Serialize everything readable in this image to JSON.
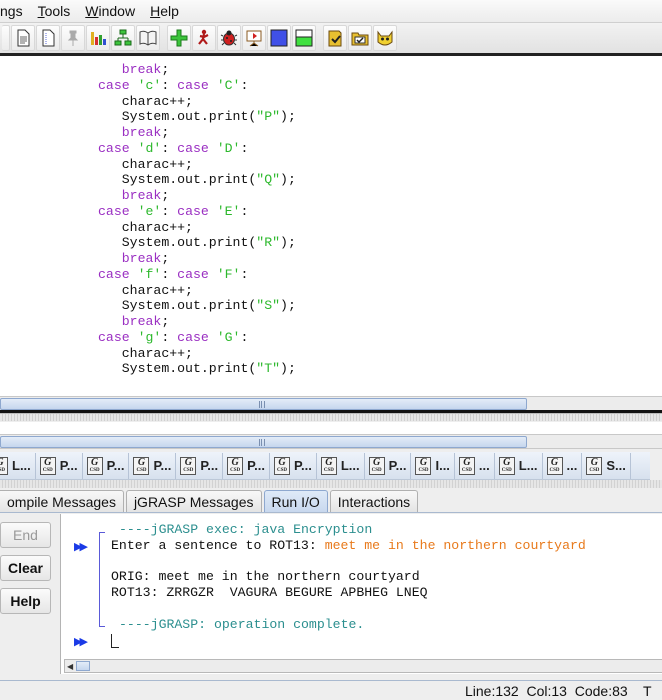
{
  "menubar": {
    "items": [
      {
        "label": "ngs",
        "mnemonic": ""
      },
      {
        "label": "Tools",
        "mnemonic": "T"
      },
      {
        "label": "Window",
        "mnemonic": "W"
      },
      {
        "label": "Help",
        "mnemonic": "H"
      }
    ]
  },
  "toolbar": {
    "icons": [
      "partial-icon",
      "new-file-icon",
      "new-doc-icon",
      "pin-icon",
      "bar-chart-icon",
      "hierarchy-icon",
      "book-icon",
      "add-icon",
      "run-icon",
      "debug-bug-icon",
      "presentation-icon",
      "blue-square-icon",
      "green-panel-icon",
      "checklist-icon",
      "folder-check-icon",
      "cat-icon"
    ]
  },
  "editor": {
    "lines": [
      {
        "indent": "   ",
        "parts": [
          {
            "t": "break",
            "c": "kw"
          },
          {
            "t": ";",
            "c": ""
          }
        ]
      },
      {
        "indent": "",
        "parts": [
          {
            "t": "case",
            "c": "kw"
          },
          {
            "t": " ",
            "c": ""
          },
          {
            "t": "'c'",
            "c": "str"
          },
          {
            "t": ": ",
            "c": ""
          },
          {
            "t": "case",
            "c": "kw"
          },
          {
            "t": " ",
            "c": ""
          },
          {
            "t": "'C'",
            "c": "str"
          },
          {
            "t": ":",
            "c": ""
          }
        ]
      },
      {
        "indent": "   ",
        "parts": [
          {
            "t": "charac++;",
            "c": ""
          }
        ]
      },
      {
        "indent": "   ",
        "parts": [
          {
            "t": "System.out.print(",
            "c": ""
          },
          {
            "t": "\"P\"",
            "c": "str"
          },
          {
            "t": ");",
            "c": ""
          }
        ]
      },
      {
        "indent": "   ",
        "parts": [
          {
            "t": "break",
            "c": "kw"
          },
          {
            "t": ";",
            "c": ""
          }
        ]
      },
      {
        "indent": "",
        "parts": [
          {
            "t": "case",
            "c": "kw"
          },
          {
            "t": " ",
            "c": ""
          },
          {
            "t": "'d'",
            "c": "str"
          },
          {
            "t": ": ",
            "c": ""
          },
          {
            "t": "case",
            "c": "kw"
          },
          {
            "t": " ",
            "c": ""
          },
          {
            "t": "'D'",
            "c": "str"
          },
          {
            "t": ":",
            "c": ""
          }
        ]
      },
      {
        "indent": "   ",
        "parts": [
          {
            "t": "charac++;",
            "c": ""
          }
        ]
      },
      {
        "indent": "   ",
        "parts": [
          {
            "t": "System.out.print(",
            "c": ""
          },
          {
            "t": "\"Q\"",
            "c": "str"
          },
          {
            "t": ");",
            "c": ""
          }
        ]
      },
      {
        "indent": "   ",
        "parts": [
          {
            "t": "break",
            "c": "kw"
          },
          {
            "t": ";",
            "c": ""
          }
        ]
      },
      {
        "indent": "",
        "parts": [
          {
            "t": "case",
            "c": "kw"
          },
          {
            "t": " ",
            "c": ""
          },
          {
            "t": "'e'",
            "c": "str"
          },
          {
            "t": ": ",
            "c": ""
          },
          {
            "t": "case",
            "c": "kw"
          },
          {
            "t": " ",
            "c": ""
          },
          {
            "t": "'E'",
            "c": "str"
          },
          {
            "t": ":",
            "c": ""
          }
        ]
      },
      {
        "indent": "   ",
        "parts": [
          {
            "t": "charac++;",
            "c": ""
          }
        ]
      },
      {
        "indent": "   ",
        "parts": [
          {
            "t": "System.out.print(",
            "c": ""
          },
          {
            "t": "\"R\"",
            "c": "str"
          },
          {
            "t": ");",
            "c": ""
          }
        ]
      },
      {
        "indent": "   ",
        "parts": [
          {
            "t": "break",
            "c": "kw"
          },
          {
            "t": ";",
            "c": ""
          }
        ]
      },
      {
        "indent": "",
        "parts": [
          {
            "t": "case",
            "c": "kw"
          },
          {
            "t": " ",
            "c": ""
          },
          {
            "t": "'f'",
            "c": "str"
          },
          {
            "t": ": ",
            "c": ""
          },
          {
            "t": "case",
            "c": "kw"
          },
          {
            "t": " ",
            "c": ""
          },
          {
            "t": "'F'",
            "c": "str"
          },
          {
            "t": ":",
            "c": ""
          }
        ]
      },
      {
        "indent": "   ",
        "parts": [
          {
            "t": "charac++;",
            "c": ""
          }
        ]
      },
      {
        "indent": "   ",
        "parts": [
          {
            "t": "System.out.print(",
            "c": ""
          },
          {
            "t": "\"S\"",
            "c": "str"
          },
          {
            "t": ");",
            "c": ""
          }
        ]
      },
      {
        "indent": "   ",
        "parts": [
          {
            "t": "break",
            "c": "kw"
          },
          {
            "t": ";",
            "c": ""
          }
        ]
      },
      {
        "indent": "",
        "parts": [
          {
            "t": "case",
            "c": "kw"
          },
          {
            "t": " ",
            "c": ""
          },
          {
            "t": "'g'",
            "c": "str"
          },
          {
            "t": ": ",
            "c": ""
          },
          {
            "t": "case",
            "c": "kw"
          },
          {
            "t": " ",
            "c": ""
          },
          {
            "t": "'G'",
            "c": "str"
          },
          {
            "t": ":",
            "c": ""
          }
        ]
      },
      {
        "indent": "   ",
        "parts": [
          {
            "t": "charac++;",
            "c": ""
          }
        ]
      },
      {
        "indent": "   ",
        "parts": [
          {
            "t": "System.out.print(",
            "c": ""
          },
          {
            "t": "\"T\"",
            "c": "str"
          },
          {
            "t": ");",
            "c": ""
          }
        ]
      }
    ]
  },
  "file_tabs": [
    {
      "label": "L..."
    },
    {
      "label": "P..."
    },
    {
      "label": "P..."
    },
    {
      "label": "P..."
    },
    {
      "label": "P..."
    },
    {
      "label": "P..."
    },
    {
      "label": "P..."
    },
    {
      "label": "L..."
    },
    {
      "label": "P..."
    },
    {
      "label": "I..."
    },
    {
      "label": "..."
    },
    {
      "label": "L..."
    },
    {
      "label": "..."
    },
    {
      "label": "S..."
    }
  ],
  "file_tab_icon_text": {
    "g": "G",
    "sub": "CSD"
  },
  "message_tabs": [
    {
      "label": "ompile Messages",
      "active": false
    },
    {
      "label": "jGRASP Messages",
      "active": false
    },
    {
      "label": "Run I/O",
      "active": true
    },
    {
      "label": "Interactions",
      "active": false
    }
  ],
  "side_buttons": {
    "end": "End",
    "clear": "Clear",
    "help": "Help"
  },
  "run_io": {
    "exec_line": "----jGRASP exec: java Encryption",
    "prompt": "Enter a sentence to ROT13: ",
    "user_input": "meet me in the northern courtyard",
    "orig_line": "ORIG: meet me in the northern courtyard",
    "rot_line": "ROT13: ZRRGZR  VAGURA BEGURE APBHEG LNEQ",
    "complete_line": "----jGRASP: operation complete.",
    "arrow_glyph": "▶▶"
  },
  "statusbar": {
    "text": "Line:132  Col:13  Code:83    T"
  },
  "colors": {
    "keyword": "#9a2fc2",
    "string": "#2cb82c",
    "io_teal": "#2c8f8f",
    "io_input": "#e87a1c",
    "arrow": "#1a3ae6"
  }
}
